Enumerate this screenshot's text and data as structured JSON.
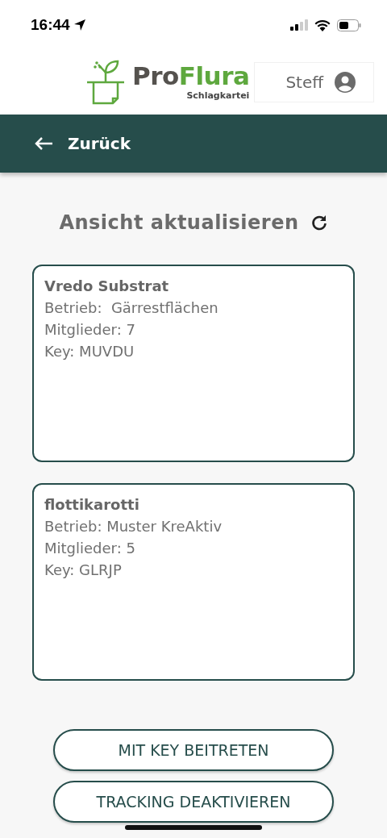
{
  "status_bar": {
    "time": "16:44"
  },
  "header": {
    "brand": [
      "Pro",
      "Flura"
    ],
    "subtitle": "Schlagkartei",
    "user": "Steff"
  },
  "nav": {
    "back_label": "Zurück"
  },
  "refresh": {
    "label": "Ansicht aktualisieren"
  },
  "groups": [
    {
      "name": "Vredo Substrat",
      "lines": [
        "Betrieb:  Gärrestflächen",
        "Mitglieder: 7",
        "Key: MUVDU"
      ]
    },
    {
      "name": "flottikarotti",
      "lines": [
        "Betrieb: Muster KreAktiv",
        "Mitglieder: 5",
        "Key: GLRJP"
      ]
    }
  ],
  "buttons": [
    "MIT KEY BEITRETEN",
    "TRACKING DEAKTIVIEREN"
  ]
}
